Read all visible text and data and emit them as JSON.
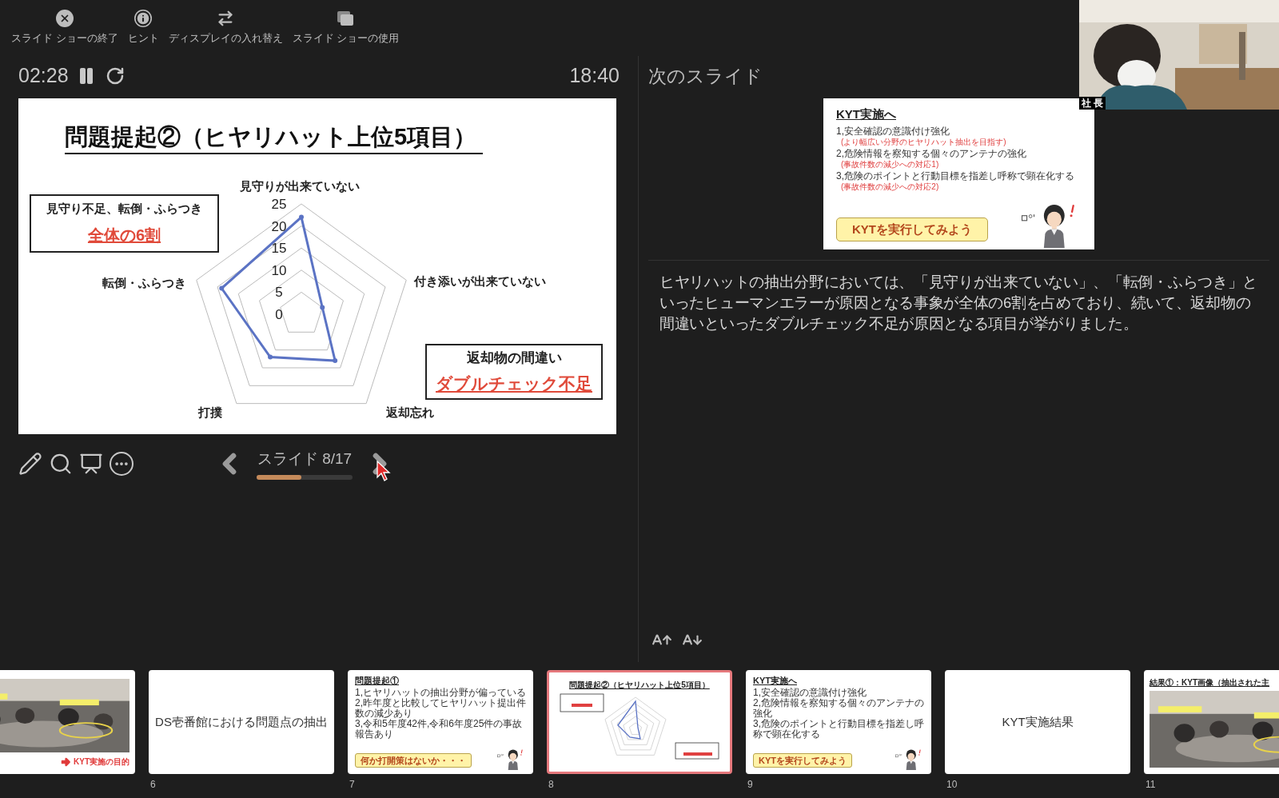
{
  "toolbar": [
    {
      "kind": "close",
      "label": "スライド ショーの終了"
    },
    {
      "kind": "info",
      "label": "ヒント"
    },
    {
      "kind": "swap",
      "label": "ディスプレイの入れ替え"
    },
    {
      "kind": "screens",
      "label": "スライド ショーの使用"
    }
  ],
  "timer": {
    "elapsed": "02:28",
    "clock": "18:40"
  },
  "current_slide": {
    "title": "問題提起②（ヒヤリハット上位5項目）",
    "callout_left": {
      "line": "見守り不足、転倒・ふらつき",
      "emphasis": "全体の6割"
    },
    "callout_right": {
      "line": "返却物の間違い",
      "emphasis": "ダブルチェック不足"
    },
    "radar": {
      "axes": [
        "見守りが出来ていない",
        "付き添いが出来ていない",
        "返却忘れ",
        "打撲",
        "転倒・ふらつき"
      ],
      "ticks": [
        "25",
        "20",
        "15",
        "10",
        "5",
        "0"
      ]
    }
  },
  "navigation": {
    "label": "スライド 8/17",
    "level": 0.47
  },
  "next_slide": {
    "heading": "次のスライド",
    "title": "KYT実施へ",
    "items": [
      {
        "text": "1,安全確認の意識付け強化",
        "note": "(より幅広い分野のヒヤリハット抽出を目指す)"
      },
      {
        "text": "2,危険情報を察知する個々のアンテナの強化",
        "note": "(事故件数の減少への対応1)"
      },
      {
        "text": "3,危険のポイントと行動目標を指差し呼称で顕在化する",
        "note": "(事故件数の減少への対応2)"
      }
    ],
    "button": "KYTを実行してみよう"
  },
  "notes": "ヒヤリハットの抽出分野においては、「見守りが出来ていない」、「転倒・ふらつき」といったヒューマンエラーが原因となる事象が全体の6割を占めており、続いて、返却物の間違いといったダブルチェック不足が原因となる項目が挙がりました。",
  "webcam": {
    "name_tag": "社 長"
  },
  "thumbnails": [
    {
      "selected": false,
      "caption": "KYT実施の目的"
    },
    {
      "kind": "title",
      "number": "6",
      "selected": false,
      "title": "DS壱番館における問題点の抽出"
    },
    {
      "kind": "bullets",
      "number": "7",
      "selected": false,
      "title": "問題提起①",
      "items": [
        "1,ヒヤリハットの抽出分野が偏っている",
        "2,昨年度と比較してヒヤリハット提出件数の減少あり",
        "3,令和5年度42件,令和6年度25件の事故報告あり"
      ],
      "button": "何か打開策はないか・・・"
    },
    {
      "kind": "chart",
      "number": "8",
      "selected": true,
      "title": "問題提起②（ヒヤリハット上位5項目）"
    },
    {
      "kind": "bullets",
      "number": "9",
      "selected": false,
      "title": "KYT実施へ",
      "items": [
        "1,安全確認の意識付け強化",
        "2,危険情報を察知する個々のアンテナの強化",
        "3,危険のポイントと行動目標を指差し呼称で顕在化する"
      ],
      "button": "KYTを実行してみよう"
    },
    {
      "kind": "title",
      "number": "10",
      "selected": false,
      "title": "KYT実施結果"
    },
    {
      "number": "11",
      "selected": false,
      "title": "結果①：KYT画像（抽出された主"
    }
  ]
}
